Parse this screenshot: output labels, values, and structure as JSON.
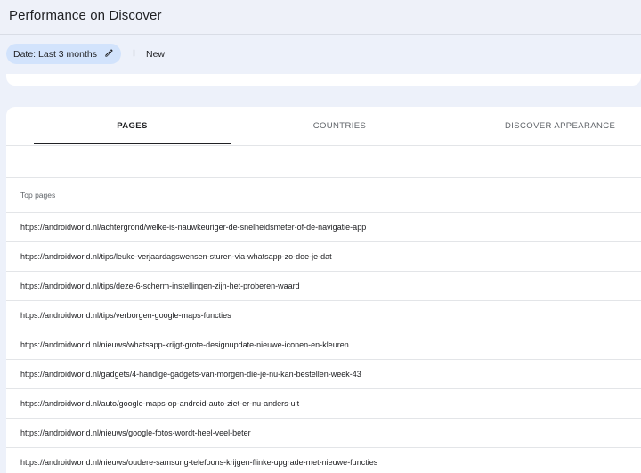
{
  "header": {
    "title": "Performance on Discover"
  },
  "filters": {
    "date_chip_label": "Date: Last 3 months",
    "new_label": "New"
  },
  "tabs": [
    {
      "label": "PAGES",
      "active": true
    },
    {
      "label": "COUNTRIES",
      "active": false
    },
    {
      "label": "DISCOVER APPEARANCE",
      "active": false
    }
  ],
  "table": {
    "column_header": "Top pages",
    "rows": [
      "https://androidworld.nl/achtergrond/welke-is-nauwkeuriger-de-snelheidsmeter-of-de-navigatie-app",
      "https://androidworld.nl/tips/leuke-verjaardagswensen-sturen-via-whatsapp-zo-doe-je-dat",
      "https://androidworld.nl/tips/deze-6-scherm-instellingen-zijn-het-proberen-waard",
      "https://androidworld.nl/tips/verborgen-google-maps-functies",
      "https://androidworld.nl/nieuws/whatsapp-krijgt-grote-designupdate-nieuwe-iconen-en-kleuren",
      "https://androidworld.nl/gadgets/4-handige-gadgets-van-morgen-die-je-nu-kan-bestellen-week-43",
      "https://androidworld.nl/auto/google-maps-op-android-auto-ziet-er-nu-anders-uit",
      "https://androidworld.nl/nieuws/google-fotos-wordt-heel-veel-beter",
      "https://androidworld.nl/nieuws/oudere-samsung-telefoons-krijgen-flinke-upgrade-met-nieuwe-functies"
    ]
  },
  "icons": {
    "edit": "pencil-icon",
    "add": "plus-icon"
  }
}
